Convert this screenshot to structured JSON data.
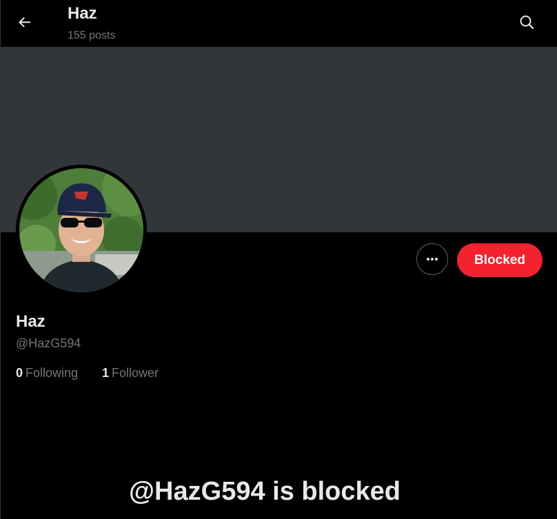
{
  "header": {
    "title": "Haz",
    "posts_count": "155 posts",
    "back_icon": "arrow-left-icon",
    "search_icon": "search-icon"
  },
  "colors": {
    "background": "#000000",
    "banner": "#333639",
    "blocked_button": "#f4212e",
    "primary_text": "#e7e9ea",
    "secondary_text": "#71767b"
  },
  "profile": {
    "display_name": "Haz",
    "handle": "@HazG594",
    "following_count": "0",
    "following_label": "Following",
    "followers_count": "1",
    "followers_label": "Follower"
  },
  "actions": {
    "more_icon": "more-horizontal-icon",
    "blocked_label": "Blocked"
  },
  "blocked_notice": {
    "heading": "@HazG594 is blocked"
  }
}
